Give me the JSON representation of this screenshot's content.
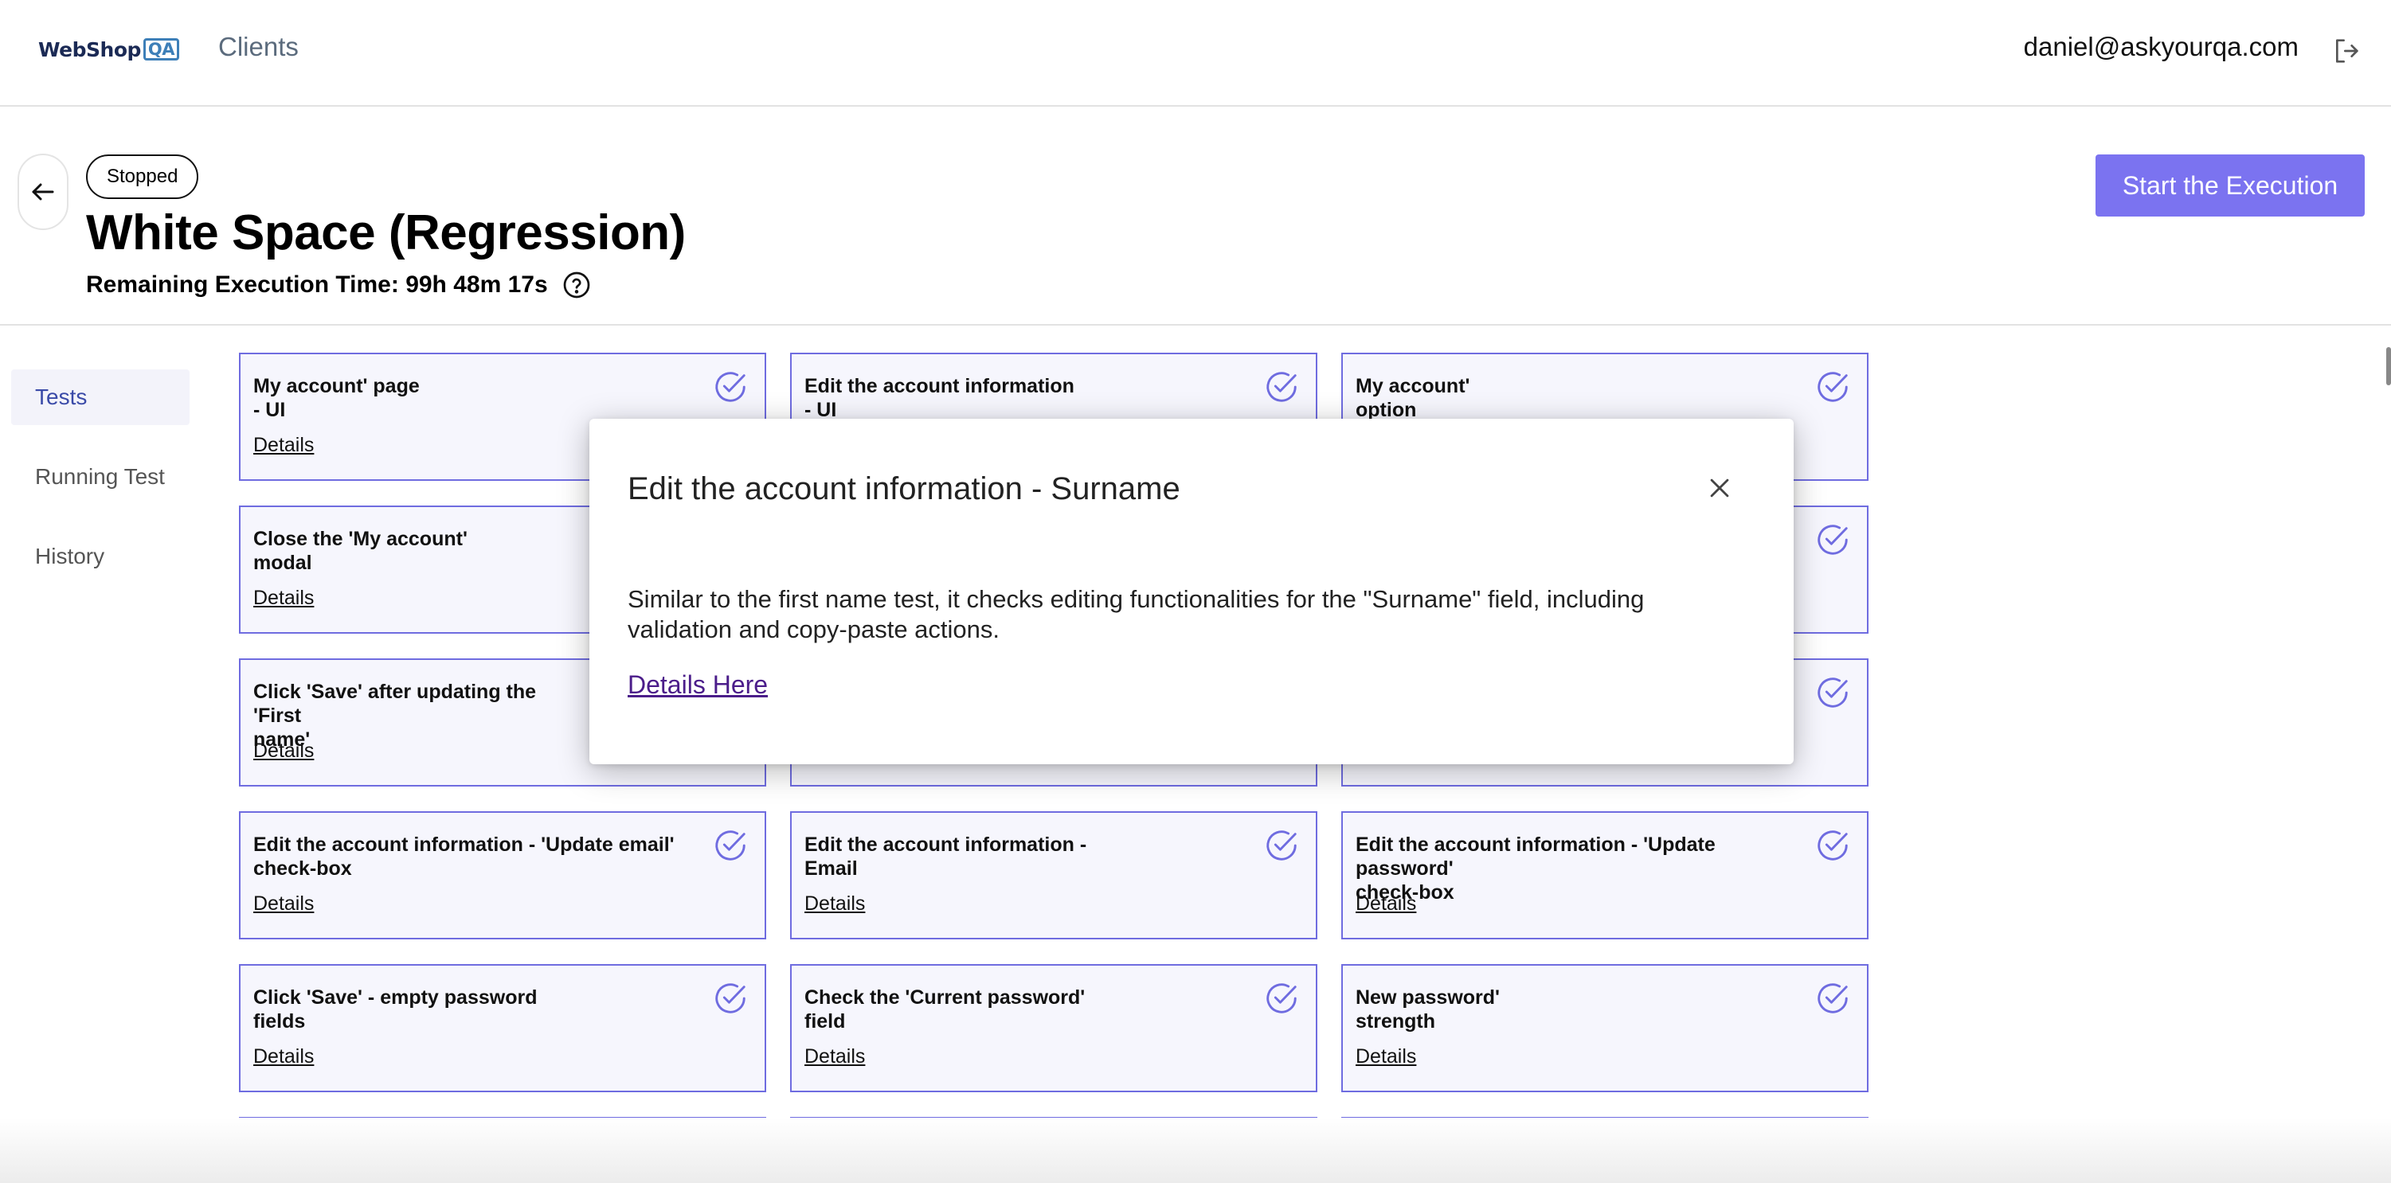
{
  "header": {
    "logo_text": "WebShop",
    "logo_badge": "QA",
    "nav_clients": "Clients",
    "user_email": "daniel@askyourqa.com"
  },
  "execution": {
    "status": "Stopped",
    "title": "White Space (Regression)",
    "remaining_label": "Remaining Execution Time: 99h 48m 17s",
    "start_button": "Start the Execution"
  },
  "sidebar": {
    "items": [
      {
        "label": "Tests",
        "active": true
      },
      {
        "label": "Running Test",
        "active": false
      },
      {
        "label": "History",
        "active": false
      }
    ]
  },
  "tests": {
    "details_label": "Details",
    "cards": [
      {
        "title": "My account' page\n- UI"
      },
      {
        "title": "Edit the account information\n- UI"
      },
      {
        "title": "My account'\noption"
      },
      {
        "title": "Close the 'My account'\nmodal"
      },
      {
        "title": ""
      },
      {
        "title": ""
      },
      {
        "title": "Click 'Save' after updating the 'First\nname'"
      },
      {
        "title": ""
      },
      {
        "title": ""
      },
      {
        "title": "Edit the account information - 'Update email'\ncheck-box"
      },
      {
        "title": "Edit the account information -\nEmail"
      },
      {
        "title": "Edit the account information - 'Update password'\ncheck-box"
      },
      {
        "title": "Click 'Save' - empty password\nfields"
      },
      {
        "title": "Check the 'Current password'\nfield"
      },
      {
        "title": "New password'\nstrength"
      }
    ]
  },
  "modal": {
    "title": "Edit the account information - Surname",
    "description": "Similar to the first name test, it checks editing functionalities for the \"Surname\" field, including validation and copy-paste actions.",
    "link": "Details Here"
  },
  "colors": {
    "accent": "#7b73f0",
    "card_border": "#6f6ce0",
    "card_bg": "#f6f6fd",
    "sidebar_active": "#3a4aa8"
  }
}
